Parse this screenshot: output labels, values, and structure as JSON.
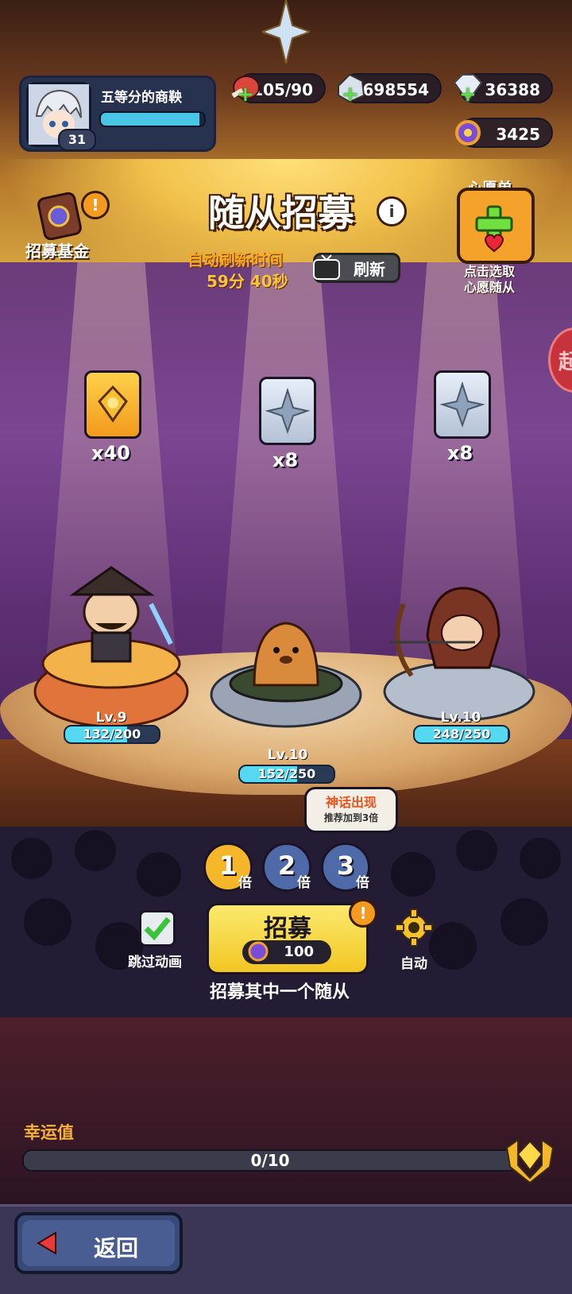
{
  "player": {
    "name": "五等分的商鞅",
    "level": "31",
    "exp_fraction": 0.95
  },
  "resources": {
    "stamina": "105/90",
    "crystals": "698554",
    "diamonds": "36388",
    "tickets": "3425"
  },
  "header": {
    "title": "随从招募",
    "refresh_label": "自动刷新时间",
    "refresh_time": "59分 40秒",
    "refresh_button": "刷新"
  },
  "fund": {
    "label": "招募基金",
    "alert": "!"
  },
  "wishlist": {
    "title": "心愿单",
    "subtitle_line1": "点击选取",
    "subtitle_line2": "心愿随从"
  },
  "side_tab": {
    "label": "起"
  },
  "rewards": [
    {
      "count": "x40"
    },
    {
      "count": "x8"
    },
    {
      "count": "x8"
    }
  ],
  "heroes": [
    {
      "level": "Lv.9",
      "hp": "132/200",
      "fraction": 0.66
    },
    {
      "level": "Lv.10",
      "hp": "152/250",
      "fraction": 0.608
    },
    {
      "level": "Lv.10",
      "hp": "248/250",
      "fraction": 0.992
    }
  ],
  "multipliers": [
    {
      "num": "1",
      "unit": "倍"
    },
    {
      "num": "2",
      "unit": "倍"
    },
    {
      "num": "3",
      "unit": "倍"
    }
  ],
  "bubble": {
    "line1": "神话出现",
    "line2": "推荐加到3倍"
  },
  "controls": {
    "skip_label": "跳过动画",
    "recruit_label": "招募",
    "recruit_cost": "100",
    "recruit_alert": "!",
    "auto_label": "自动",
    "recruit_desc": "招募其中一个随从"
  },
  "luck": {
    "label": "幸运值",
    "value": "0/10",
    "fraction": 0
  },
  "footer": {
    "back_label": "返回"
  }
}
